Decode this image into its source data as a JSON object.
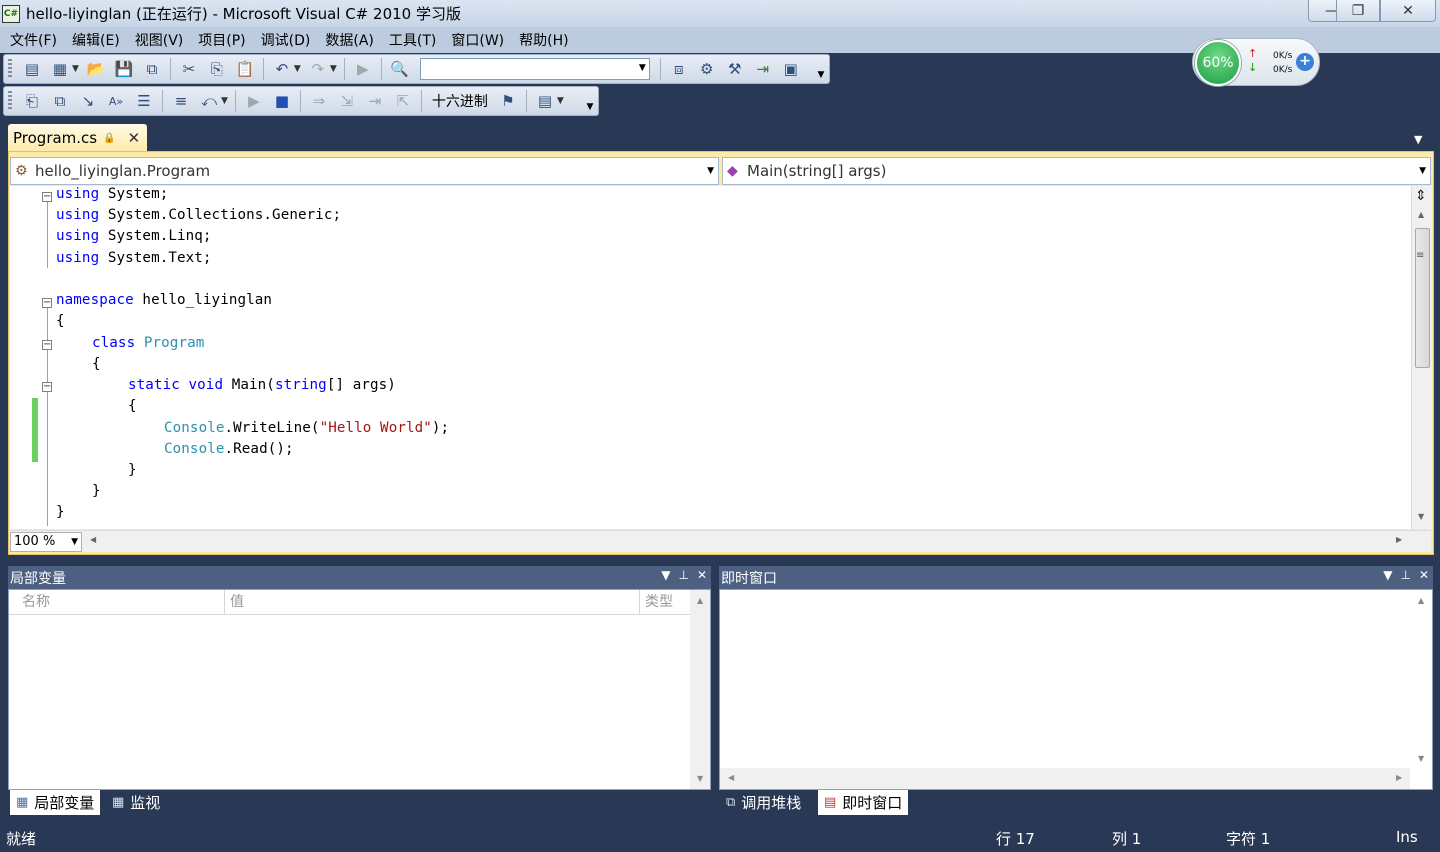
{
  "window": {
    "title": "hello-liyinglan (正在运行) - Microsoft Visual C# 2010 学习版",
    "icon_text": "C#",
    "minimize_glyph": "—",
    "maximize_glyph": "❐",
    "close_glyph": "✕"
  },
  "menu": [
    "文件(F)",
    "编辑(E)",
    "视图(V)",
    "项目(P)",
    "调试(D)",
    "数据(A)",
    "工具(T)",
    "窗口(W)",
    "帮助(H)"
  ],
  "toolbar": {
    "config_value": "",
    "hex_label": "十六进制"
  },
  "network_widget": {
    "percent": "60%",
    "upload": "0K/s",
    "download": "0K/s"
  },
  "document_tab": {
    "label": "Program.cs"
  },
  "navigation": {
    "class_selector": "hello_liyinglan.Program",
    "member_selector": "Main(string[] args)"
  },
  "zoom": "100 %",
  "tool_windows": {
    "locals": {
      "title": "局部变量",
      "columns": [
        "名称",
        "值",
        "类型"
      ]
    },
    "immediate": {
      "title": "即时窗口"
    }
  },
  "bottom_tabs_left": [
    {
      "label": "局部变量",
      "active": true
    },
    {
      "label": "监视",
      "active": false
    }
  ],
  "bottom_tabs_right": [
    {
      "label": "调用堆栈",
      "active": false
    },
    {
      "label": "即时窗口",
      "active": true
    }
  ],
  "status": {
    "message": "就绪",
    "line": "行 17",
    "column": "列 1",
    "char": "字符 1",
    "mode": "Ins"
  },
  "code": {
    "line1": [
      "using",
      " System;"
    ],
    "line2": [
      "using",
      " System.Collections.Generic;"
    ],
    "line3": [
      "using",
      " System.Linq;"
    ],
    "line4": [
      "using",
      " System.Text;"
    ],
    "line6": [
      "namespace",
      " hello_liyinglan"
    ],
    "line7": "{",
    "line8": [
      "class",
      "Program"
    ],
    "line9": "{",
    "line10": [
      "static",
      "void",
      " Main(",
      "string",
      "[] args)"
    ],
    "line11": "{",
    "line12": [
      "Console",
      ".WriteLine(",
      "\"Hello World\"",
      ");"
    ],
    "line13": [
      "Console",
      ".Read();"
    ],
    "line14": "}",
    "line15": "}",
    "line16": "}"
  }
}
